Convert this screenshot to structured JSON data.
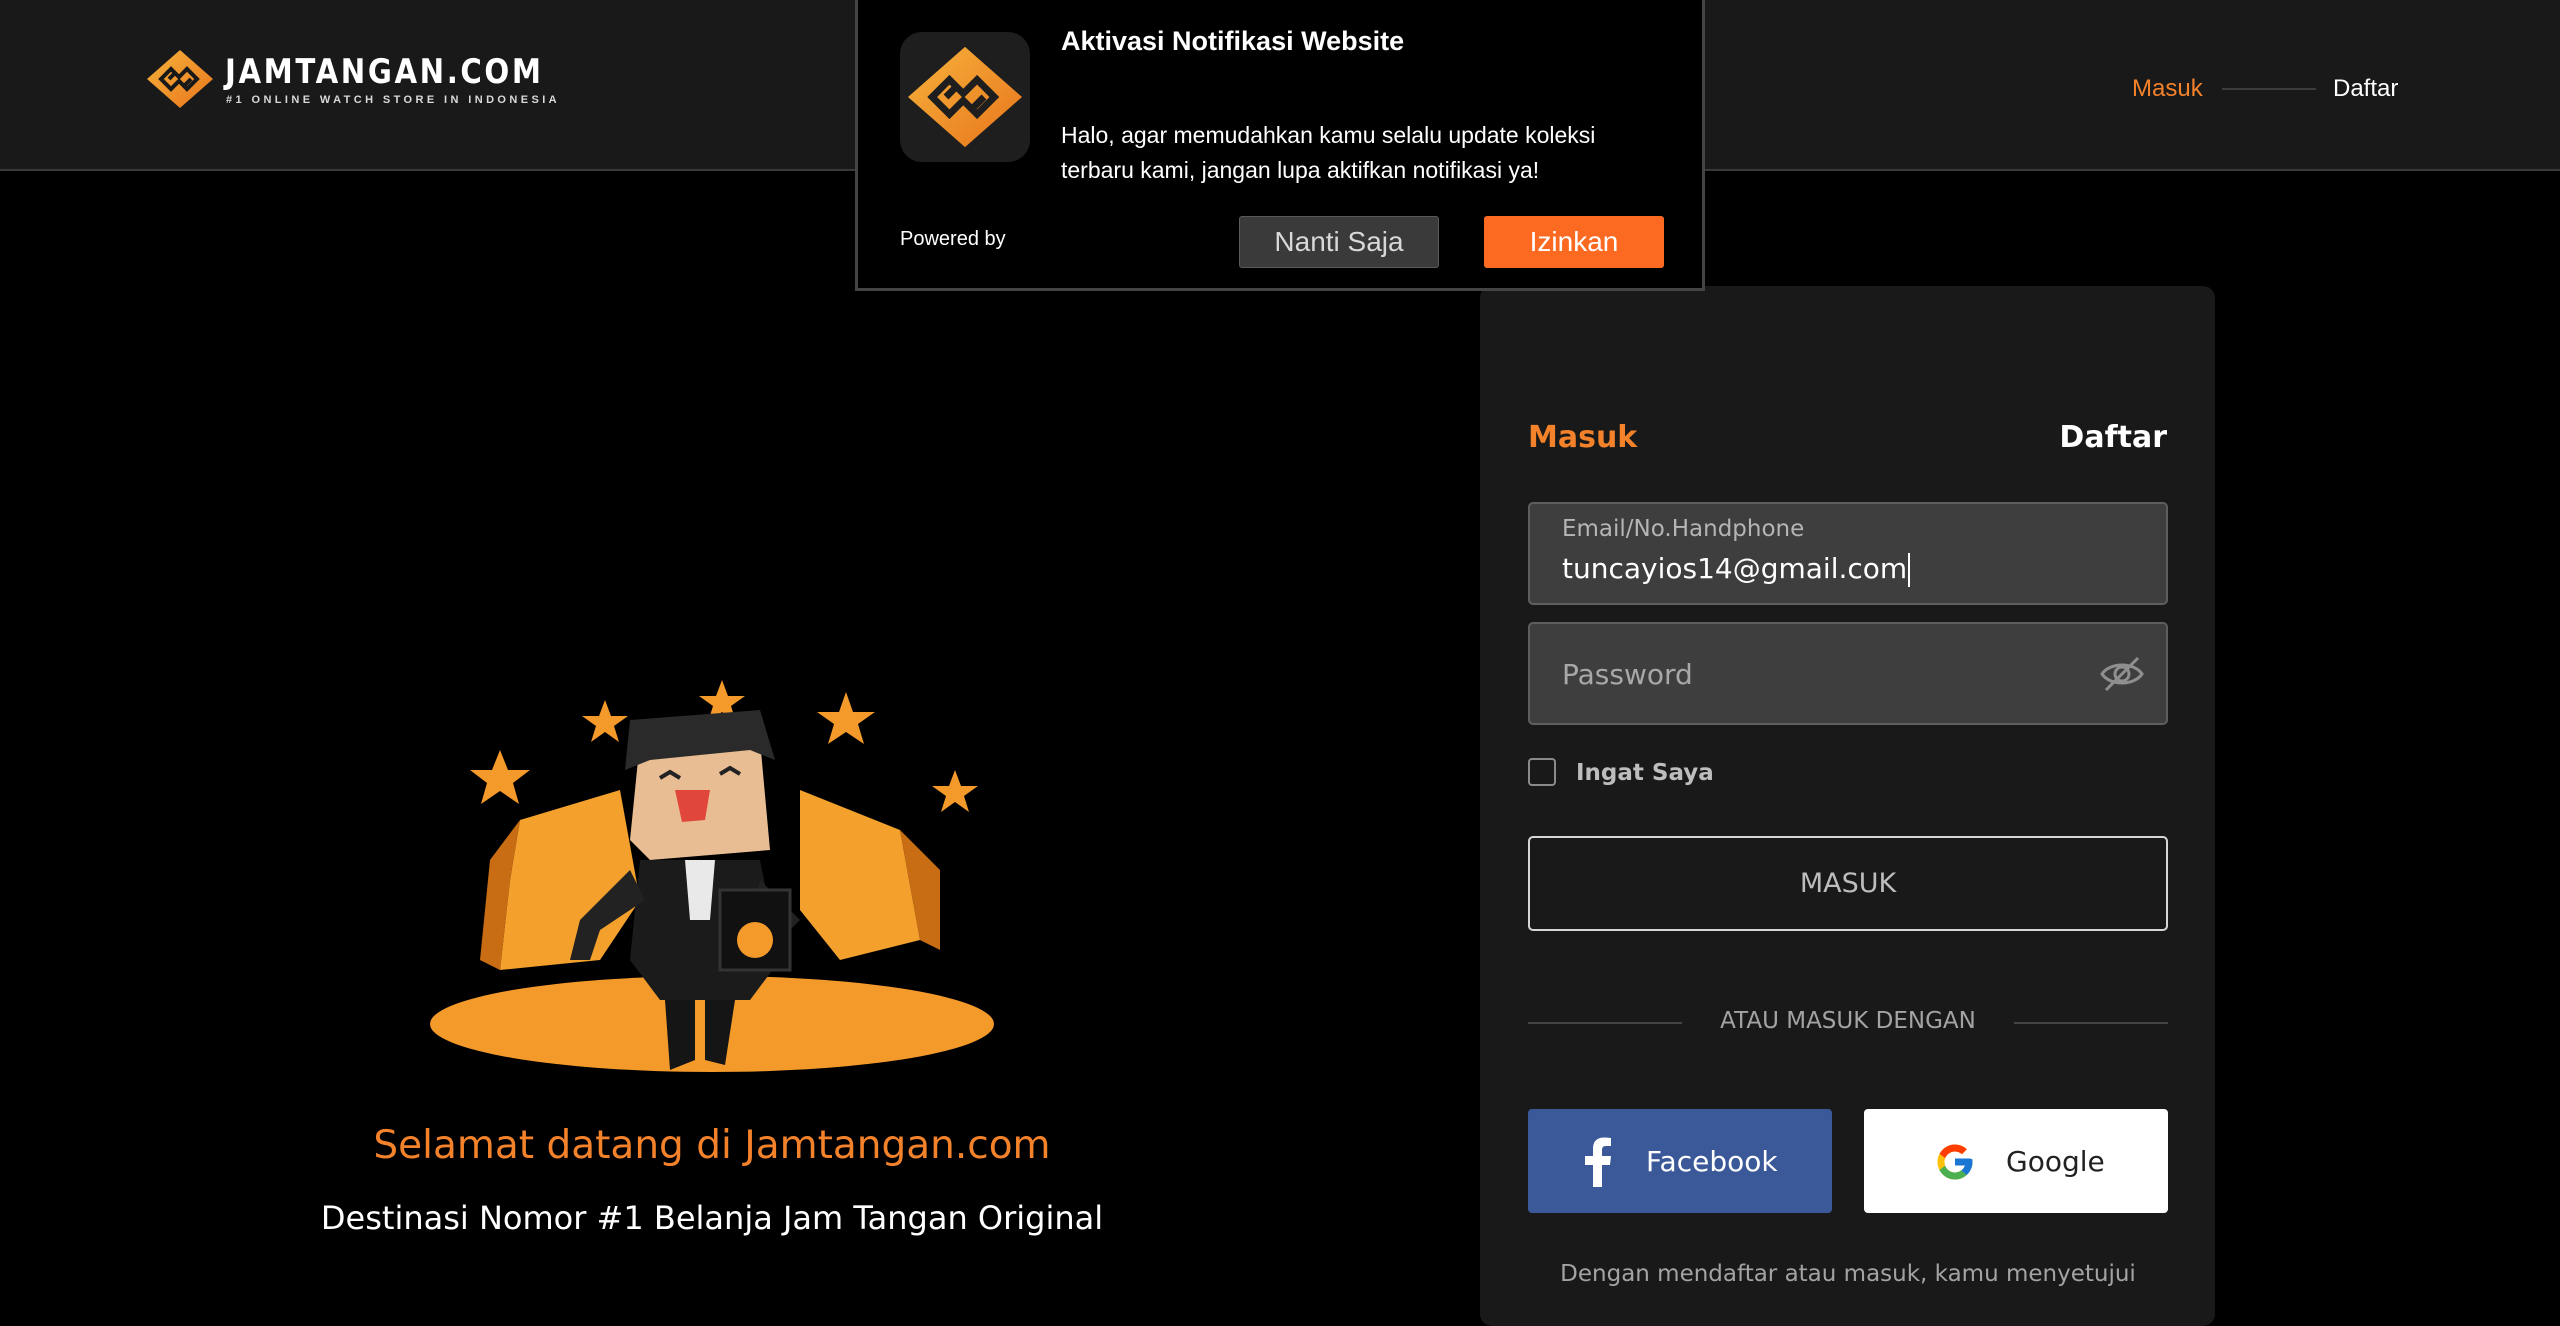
{
  "header": {
    "logo_text": "JAMTANGAN.COM",
    "logo_tagline": "#1 ONLINE WATCH STORE IN INDONESIA",
    "nav_login": "Masuk",
    "nav_register": "Daftar"
  },
  "notification": {
    "title": "Aktivasi Notifikasi Website",
    "body": "Halo, agar memudahkan kamu selalu update koleksi terbaru kami, jangan lupa aktifkan notifikasi ya!",
    "powered_by": "Powered by",
    "later_label": "Nanti Saja",
    "allow_label": "Izinkan"
  },
  "hero": {
    "welcome": "Selamat datang di Jamtangan.com",
    "subtitle": "Destinasi Nomor #1 Belanja Jam Tangan Original"
  },
  "login": {
    "tab_login": "Masuk",
    "tab_register": "Daftar",
    "email_label": "Email/No.Handphone",
    "email_value": "tuncayios14@gmail.com",
    "password_placeholder": "Password",
    "remember_label": "Ingat Saya",
    "submit_label": "MASUK",
    "or_text": "ATAU MASUK DENGAN",
    "facebook_label": "Facebook",
    "google_label": "Google",
    "terms_text": "Dengan mendaftar atau masuk, kamu menyetujui"
  },
  "colors": {
    "accent": "#f4822b",
    "allow_button": "#fc6a22",
    "facebook": "#3b5998",
    "header_bg": "#191919",
    "card_bg": "#191919"
  },
  "icons": {
    "logo": "jamtangan-logo-icon",
    "eye": "eye-slash-icon",
    "facebook": "facebook-icon",
    "google": "google-icon"
  }
}
